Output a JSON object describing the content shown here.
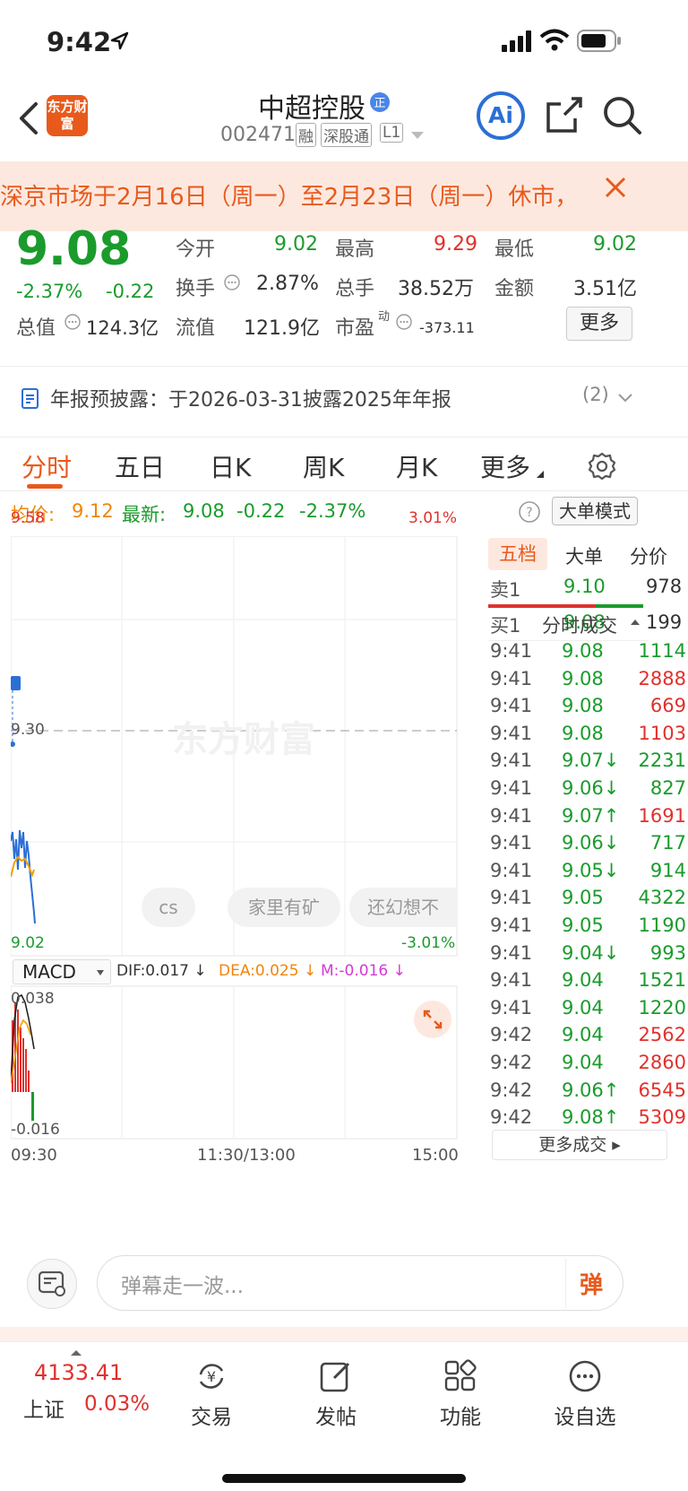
{
  "status": {
    "time": "9:42"
  },
  "header": {
    "title": "中超控股",
    "code": "002471",
    "tags": [
      "融",
      "深股通",
      "L1"
    ],
    "logo": "东方财富",
    "ai": "Ai"
  },
  "notice": {
    "text": "深京市场于2月16日（周一）至2月23日（周一）休市，"
  },
  "quote": {
    "price": "9.08",
    "pct": "-2.37%",
    "change": "-0.22",
    "fields": [
      {
        "label": "今开",
        "value": "9.02"
      },
      {
        "label": "最高",
        "value": "9.29"
      },
      {
        "label": "最低",
        "value": "9.02"
      },
      {
        "label": "换手",
        "value": "2.87%"
      },
      {
        "label": "总手",
        "value": "38.52万"
      },
      {
        "label": "金额",
        "value": "3.51亿"
      },
      {
        "label": "总值",
        "value": "124.3亿"
      },
      {
        "label": "流值",
        "value": "121.9亿"
      },
      {
        "label": "市盈",
        "sup": "动",
        "value": "-373.11"
      }
    ],
    "more": "更多"
  },
  "report": {
    "text": "年报预披露：于2026-03-31披露2025年年报",
    "count": "(2)"
  },
  "tabs": [
    "分时",
    "五日",
    "日K",
    "周K",
    "月K",
    "更多"
  ],
  "avg": {
    "avg_label": "均价:",
    "avg_value": "9.12",
    "latest_label": "最新:",
    "latest_value": "9.08",
    "chg": "-0.22",
    "pct": "-2.37%",
    "mode": "大单模式"
  },
  "chart_labels": {
    "top_price": "9.58",
    "top_pct": "3.01%",
    "mid_price": "9.30",
    "bot_price": "9.02",
    "bot_pct": "-3.01%",
    "watermark": "东方财富",
    "macd": "MACD",
    "dif": "DIF:0.017 ↓",
    "dea": "DEA:0.025 ↓",
    "m": "M:-0.016 ↓",
    "macd_top": "0.038",
    "macd_bot": "-0.016",
    "x_start": "09:30",
    "x_mid": "11:30/13:00",
    "x_end": "15:00",
    "chips": [
      "cs",
      "家里有矿",
      "还幻想不"
    ]
  },
  "side": {
    "tabs": [
      "五档",
      "大单",
      "分价"
    ],
    "sell": {
      "label": "卖1",
      "price": "9.10",
      "vol": "978"
    },
    "buy": {
      "label": "买1",
      "price": "9.08",
      "vol": "199"
    },
    "ticks_title": "分时成交",
    "ticks": [
      {
        "t": "9:41",
        "p": "9.08",
        "v": "1114",
        "pc": "green",
        "vc": "green"
      },
      {
        "t": "9:41",
        "p": "9.08",
        "v": "2888",
        "pc": "green",
        "vc": "red"
      },
      {
        "t": "9:41",
        "p": "9.08",
        "v": "669",
        "pc": "green",
        "vc": "red"
      },
      {
        "t": "9:41",
        "p": "9.08",
        "v": "1103",
        "pc": "green",
        "vc": "red"
      },
      {
        "t": "9:41",
        "p": "9.07↓",
        "v": "2231",
        "pc": "green",
        "vc": "green"
      },
      {
        "t": "9:41",
        "p": "9.06↓",
        "v": "827",
        "pc": "green",
        "vc": "green"
      },
      {
        "t": "9:41",
        "p": "9.07↑",
        "v": "1691",
        "pc": "green",
        "vc": "red"
      },
      {
        "t": "9:41",
        "p": "9.06↓",
        "v": "717",
        "pc": "green",
        "vc": "green"
      },
      {
        "t": "9:41",
        "p": "9.05↓",
        "v": "914",
        "pc": "green",
        "vc": "green"
      },
      {
        "t": "9:41",
        "p": "9.05",
        "v": "4322",
        "pc": "green",
        "vc": "green"
      },
      {
        "t": "9:41",
        "p": "9.05",
        "v": "1190",
        "pc": "green",
        "vc": "green"
      },
      {
        "t": "9:41",
        "p": "9.04↓",
        "v": "993",
        "pc": "green",
        "vc": "green"
      },
      {
        "t": "9:41",
        "p": "9.04",
        "v": "1521",
        "pc": "green",
        "vc": "green"
      },
      {
        "t": "9:41",
        "p": "9.04",
        "v": "1220",
        "pc": "green",
        "vc": "green"
      },
      {
        "t": "9:42",
        "p": "9.04",
        "v": "2562",
        "pc": "green",
        "vc": "red"
      },
      {
        "t": "9:42",
        "p": "9.04",
        "v": "2860",
        "pc": "green",
        "vc": "red"
      },
      {
        "t": "9:42",
        "p": "9.06↑",
        "v": "6545",
        "pc": "green",
        "vc": "red"
      },
      {
        "t": "9:42",
        "p": "9.08↑",
        "v": "5309",
        "pc": "green",
        "vc": "red"
      }
    ],
    "more": "更多成交"
  },
  "danmu": {
    "placeholder": "弹幕走一波...",
    "btn": "弹"
  },
  "bottom": {
    "index_value": "4133.41",
    "index_name": "上证",
    "index_pct": "0.03%",
    "items": [
      "交易",
      "发帖",
      "功能",
      "设自选"
    ]
  },
  "colors": {
    "red": "#e0312d",
    "green": "#1a9b2c",
    "orange": "#f0850b",
    "accent": "#e85a1c",
    "blue": "#2b6fd6"
  }
}
